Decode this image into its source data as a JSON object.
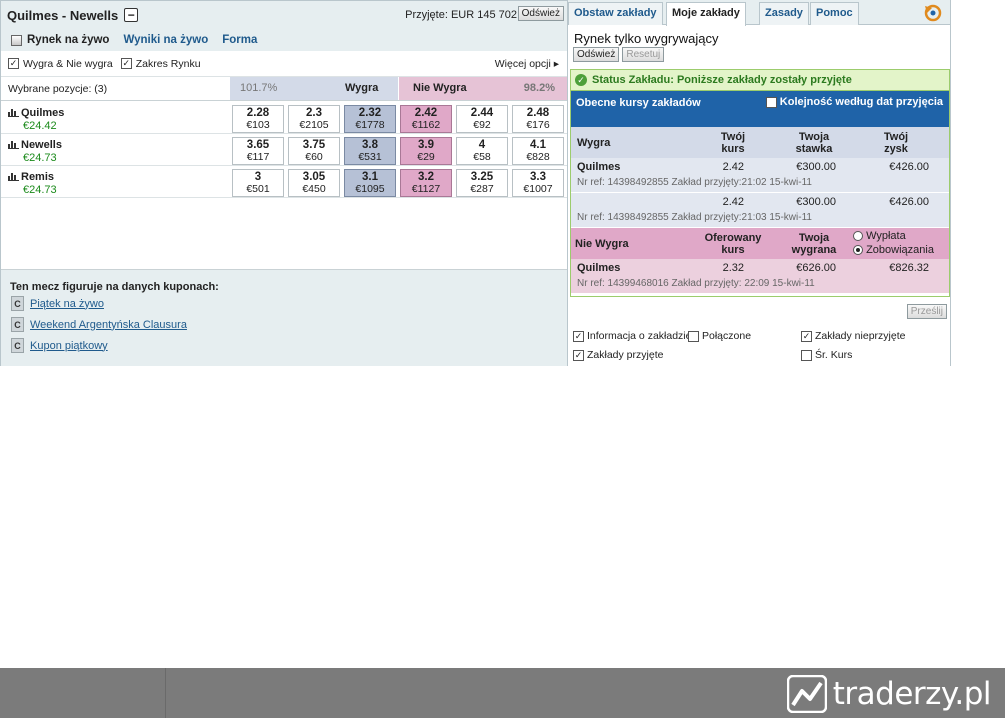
{
  "market": {
    "title": "Quilmes - Newells",
    "matched": "Przyjęte: EUR 145 702",
    "refresh": "Odśwież",
    "links": {
      "inplay": "Rynek na żywo",
      "live_results": "Wyniki na żywo",
      "form": "Forma"
    },
    "options": {
      "back_lay": "Wygra & Nie wygra",
      "market_depth": "Zakres Rynku",
      "more": "Więcej opcji"
    },
    "selected": "Wybrane pozycje:  (3)",
    "back_pct": "101.7%",
    "back_label": "Wygra",
    "lay_label": "Nie Wygra",
    "lay_pct": "98.2%",
    "runners": [
      {
        "name": "Quilmes",
        "pl": "€24.42",
        "prices": [
          {
            "odds": "2.28",
            "amt": "€103"
          },
          {
            "odds": "2.3",
            "amt": "€2105"
          },
          {
            "odds": "2.32",
            "amt": "€1778"
          },
          {
            "odds": "2.42",
            "amt": "€1162"
          },
          {
            "odds": "2.44",
            "amt": "€92"
          },
          {
            "odds": "2.48",
            "amt": "€176"
          }
        ]
      },
      {
        "name": "Newells",
        "pl": "€24.73",
        "prices": [
          {
            "odds": "3.65",
            "amt": "€117"
          },
          {
            "odds": "3.75",
            "amt": "€60"
          },
          {
            "odds": "3.8",
            "amt": "€531"
          },
          {
            "odds": "3.9",
            "amt": "€29"
          },
          {
            "odds": "4",
            "amt": "€58"
          },
          {
            "odds": "4.1",
            "amt": "€828"
          }
        ]
      },
      {
        "name": "Remis",
        "pl": "€24.73",
        "prices": [
          {
            "odds": "3",
            "amt": "€501"
          },
          {
            "odds": "3.05",
            "amt": "€450"
          },
          {
            "odds": "3.1",
            "amt": "€1095"
          },
          {
            "odds": "3.2",
            "amt": "€1127"
          },
          {
            "odds": "3.25",
            "amt": "€287"
          },
          {
            "odds": "3.3",
            "amt": "€1007"
          }
        ]
      }
    ],
    "coupons_title": "Ten mecz figuruje na danych kuponach:",
    "coupon_badge": "C",
    "coupons": [
      "Piątek na żywo",
      "Weekend Argentyńska Clausura",
      "Kupon piątkowy"
    ]
  },
  "betslip": {
    "tabs": [
      "Obstaw zakłady",
      "Moje zakłady",
      "Zasady",
      "Pomoc"
    ],
    "active_tab": "Moje zakłady",
    "market_title": "Rynek tylko wygrywający",
    "refresh": "Odśwież",
    "reset": "Resetuj",
    "status": "Status Zakładu: Poniższe zakłady zostały przyjęte",
    "current_odds": "Obecne kursy zakładów",
    "order_by_date": "Kolejność według dat przyjęcia",
    "back": {
      "h_name": "Wygra",
      "h_odds_1": "Twój",
      "h_odds_2": "kurs",
      "h_stake_1": "Twoja",
      "h_stake_2": "stawka",
      "h_profit_1": "Twój",
      "h_profit_2": "zysk",
      "bets": [
        {
          "name": "Quilmes",
          "odds": "2.42",
          "stake": "€300.00",
          "profit": "€426.00",
          "ref": "Nr ref: 14398492855 Zakład przyjęty:21:02 15-kwi-11"
        },
        {
          "name": "",
          "odds": "2.42",
          "stake": "€300.00",
          "profit": "€426.00",
          "ref": "Nr ref: 14398492855 Zakład przyjęty:21:03 15-kwi-11"
        }
      ]
    },
    "lay": {
      "h_name": "Nie Wygra",
      "h_odds_1": "Oferowany",
      "h_odds_2": "kurs",
      "h_stake_1": "Twoja",
      "h_stake_2": "wygrana",
      "payout": "Wypłata",
      "liability": "Zobowiązania",
      "bets": [
        {
          "name": "Quilmes",
          "odds": "2.32",
          "stake": "€626.00",
          "profit": "€826.32",
          "ref": "Nr ref: 14399468016 Zakład przyjęty: 22:09 15-kwi-11"
        }
      ]
    },
    "submit": "Prześlij",
    "filters": {
      "bet_info": "Informacja o zakładzie",
      "combined": "Połączone",
      "unmatched": "Zakłady nieprzyjęte",
      "matched": "Zakłady przyjęte",
      "avg_odds": "Śr. Kurs"
    }
  },
  "footer": {
    "brand": "traderzy.pl"
  },
  "colors": {
    "back": "#b6c1d6",
    "lay": "#e0a8c8",
    "header_blue": "#1f63a8",
    "status_green": "#2c7a1f",
    "link": "#1f5a8c"
  }
}
